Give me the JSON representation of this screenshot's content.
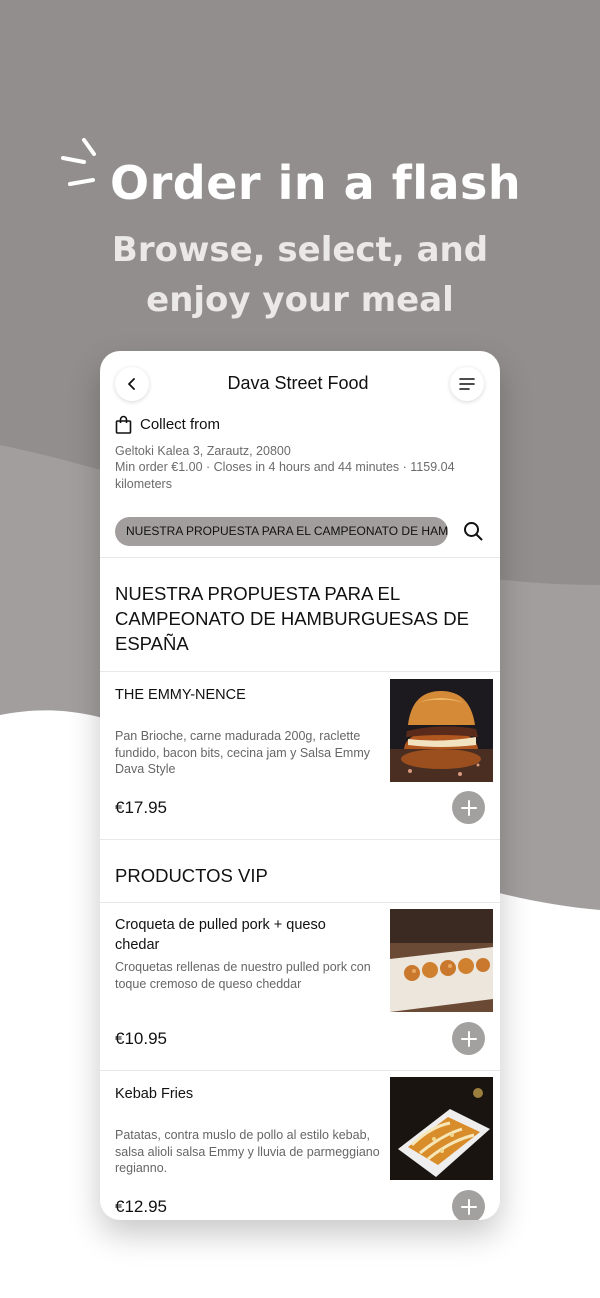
{
  "promo": {
    "headline": "Order in a flash",
    "subline_1": "Browse, select, and",
    "subline_2": "enjoy your meal"
  },
  "header": {
    "title": "Dava Street Food",
    "back_icon": "chevron-left-icon",
    "menu_icon": "hamburger-menu-icon"
  },
  "store": {
    "collect_label": "Collect from",
    "address": "Geltoki Kalea 3, Zarautz, 20800",
    "meta": "Min order €1.00 · Closes in 4 hours and 44 minutes · 1159.04 kilometers"
  },
  "category_bar": {
    "active_category": "NUESTRA PROPUESTA PARA EL CAMPEONATO DE HAMBURGUESAS DE ESPAÑA",
    "search_icon": "search-icon"
  },
  "sections": [
    {
      "title": "NUESTRA PROPUESTA PARA EL CAMPEONATO DE HAMBURGUESAS DE ESPAÑA",
      "items": [
        {
          "name": "THE EMMY-NENCE",
          "description": "Pan Brioche, carne madurada 200g, raclette fundido, bacon bits, cecina jam y Salsa Emmy Dava Style",
          "price": "€17.95",
          "image": "burger-photo"
        }
      ]
    },
    {
      "title": "PRODUCTOS VIP",
      "items": [
        {
          "name": "Croqueta de pulled pork + queso chedar",
          "description": "Croquetas rellenas de nuestro pulled pork con toque cremoso de queso cheddar",
          "price": "€10.95",
          "image": "croquetas-photo"
        },
        {
          "name": "Kebab Fries",
          "description": "Patatas, contra muslo de pollo al estilo kebab, salsa alioli salsa Emmy y lluvia de parmeggiano regianno.",
          "price": "€12.95",
          "image": "kebab-fries-photo"
        }
      ]
    }
  ],
  "colors": {
    "background_dark": "#928e8e",
    "background_mid": "#a29e9e",
    "add_button": "#a3a0a0",
    "category_pill": "#a29e9e"
  }
}
